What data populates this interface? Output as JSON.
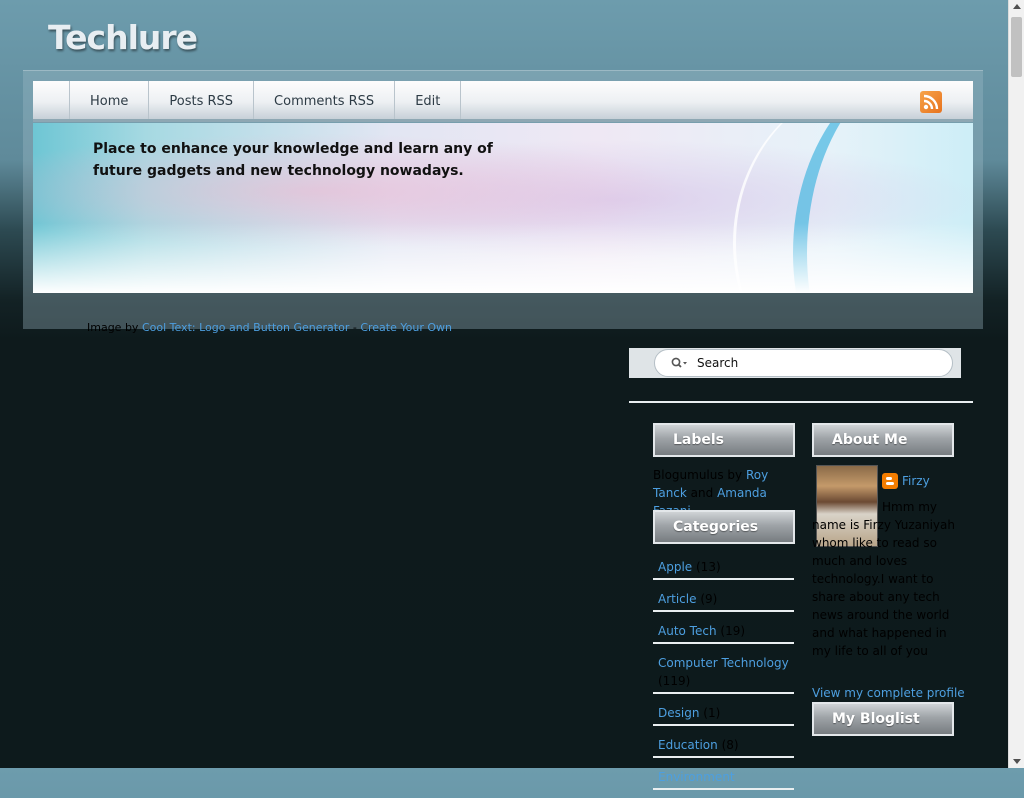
{
  "site": {
    "title": "Techlure"
  },
  "nav": {
    "items": [
      {
        "label": "Home"
      },
      {
        "label": "Posts RSS"
      },
      {
        "label": "Comments RSS"
      },
      {
        "label": "Edit"
      }
    ],
    "rss_icon": "rss-feed-icon"
  },
  "banner": {
    "tagline": "Place to enhance your knowledge and learn any of future gadgets and new technology nowadays."
  },
  "credit": {
    "prefix": "Image by ",
    "link1": "Cool Text: Logo and Button Generator",
    "separator": " - ",
    "link2": "Create Your Own"
  },
  "search": {
    "placeholder": "Search",
    "icon": "search-icon"
  },
  "labels_widget": {
    "title": "Labels",
    "prefix": "Blogumulus by ",
    "author1": "Roy Tanck",
    "joiner": " and ",
    "author2": "Amanda Fazani"
  },
  "categories_widget": {
    "title": "Categories",
    "items": [
      {
        "name": "Apple",
        "count": "(13)"
      },
      {
        "name": "Article",
        "count": "(9)"
      },
      {
        "name": "Auto Tech",
        "count": "(19)"
      },
      {
        "name": "Computer Technology",
        "count": "(119)"
      },
      {
        "name": "Design",
        "count": "(1)"
      },
      {
        "name": "Education",
        "count": "(8)"
      },
      {
        "name": "Environment",
        "count": ""
      }
    ]
  },
  "about_widget": {
    "title": "About Me",
    "name": "Firzy",
    "bio": "Hmm my name is Firzy Yuzaniyah whom like to read so much and loves technology.I want to share about any tech news around the world and what happened in my life to all of you",
    "profile_link": "View my complete profile"
  },
  "bloglist_widget": {
    "title": "My Bloglist"
  },
  "colors": {
    "link": "#4d9fe0",
    "rss": "#e7721e",
    "blogger": "#f57d00"
  }
}
